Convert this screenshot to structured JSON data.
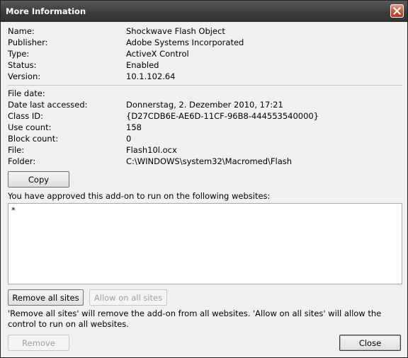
{
  "window": {
    "title": "More Information"
  },
  "details": [
    {
      "label": "Name:",
      "value": "Shockwave Flash Object"
    },
    {
      "label": "Publisher:",
      "value": "Adobe Systems Incorporated"
    },
    {
      "label": "Type:",
      "value": "ActiveX Control"
    },
    {
      "label": "Status:",
      "value": "Enabled"
    },
    {
      "label": "Version:",
      "value": "10.1.102.64"
    }
  ],
  "file_details": [
    {
      "label": "File date:",
      "value": ""
    },
    {
      "label": "Date last accessed:",
      "value": "Donnerstag, 2. Dezember 2010, 17:21"
    },
    {
      "label": "Class ID:",
      "value": "{D27CDB6E-AE6D-11CF-96B8-444553540000}"
    },
    {
      "label": "Use count:",
      "value": "158"
    },
    {
      "label": "Block count:",
      "value": "0"
    },
    {
      "label": "File:",
      "value": "Flash10l.ocx"
    },
    {
      "label": "Folder:",
      "value": "C:\\WINDOWS\\system32\\Macromed\\Flash"
    }
  ],
  "buttons": {
    "copy": "Copy",
    "remove_all_sites": "Remove all sites",
    "allow_on_all_sites": "Allow on all sites",
    "remove": "Remove",
    "close": "Close"
  },
  "sites": {
    "heading": "You have approved this add-on to run on the following websites:",
    "items": [
      "*"
    ]
  },
  "hint": "'Remove all sites' will remove the add-on from all websites. 'Allow on all sites' will allow the control to run on all websites.",
  "icons": {
    "close": "close-icon"
  }
}
